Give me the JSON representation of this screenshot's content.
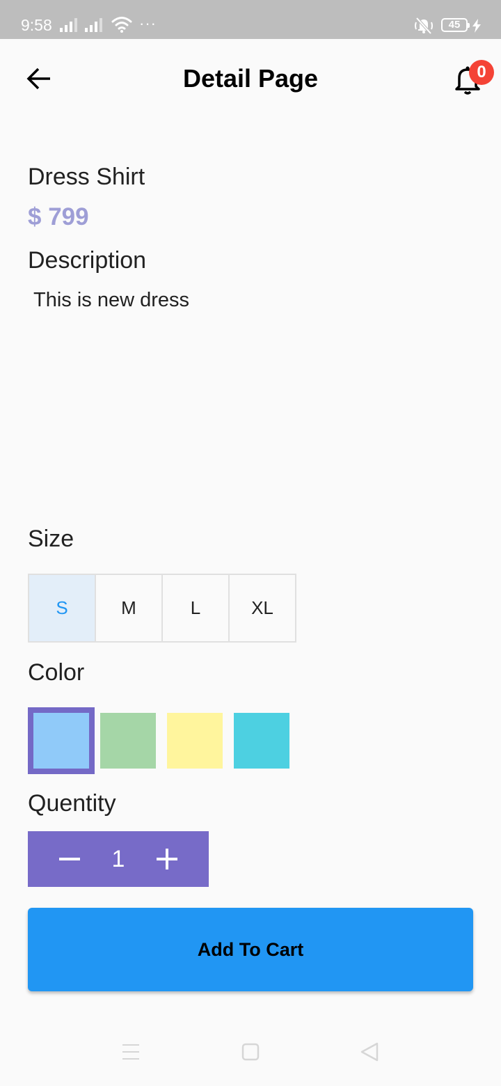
{
  "status_bar": {
    "time": "9:58",
    "dots": "···",
    "battery": "45",
    "icons": [
      "signal-icon",
      "signal-icon",
      "wifi-icon",
      "mute-icon",
      "battery-icon",
      "charging-icon"
    ]
  },
  "app_bar": {
    "title": "Detail Page",
    "back_icon": "back-arrow-icon",
    "bell_icon": "bell-icon",
    "notification_count": "0"
  },
  "product": {
    "name": "Dress Shirt",
    "price": "$ 799",
    "description_heading": "Description",
    "description": "This is new dress"
  },
  "size": {
    "heading": "Size",
    "options": [
      "S",
      "M",
      "L",
      "XL"
    ],
    "selected": "S"
  },
  "color": {
    "heading": "Color",
    "swatches": [
      "#90caf9",
      "#a5d6a7",
      "#fff59d",
      "#4dd0e1"
    ],
    "selected_index": 0,
    "selection_border": "#7469c6"
  },
  "quantity": {
    "heading": "Quentity",
    "value": "1",
    "minus_icon": "minus-icon",
    "plus_icon": "plus-icon",
    "background": "#776bc8"
  },
  "cart": {
    "button_label": "Add To Cart",
    "button_color": "#2196f3"
  },
  "colors": {
    "price": "#9e9ed6",
    "badge": "#f44336",
    "size_selected": "#2196f3"
  },
  "nav_bar": {
    "icons": [
      "menu-icon",
      "home-icon",
      "back-icon"
    ]
  }
}
